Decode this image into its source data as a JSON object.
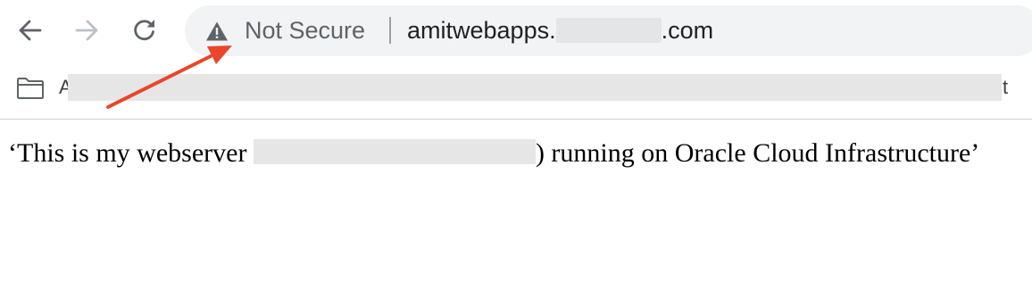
{
  "toolbar": {
    "back_icon": "arrow-left-icon",
    "forward_icon": "arrow-right-icon",
    "reload_icon": "reload-icon"
  },
  "omnibox": {
    "security_icon": "warning-triangle-icon",
    "security_label": "Not Secure",
    "url_prefix": "amitwebapps.",
    "url_suffix": ".com"
  },
  "bookmarks": {
    "folder_icon": "folder-icon",
    "first_char": "A",
    "last_char": "t"
  },
  "annotation": {
    "arrow_color": "#e8472b"
  },
  "page": {
    "text_before": "‘This is my webserver ",
    "text_after": ") running on Oracle Cloud Infrastructure’"
  }
}
